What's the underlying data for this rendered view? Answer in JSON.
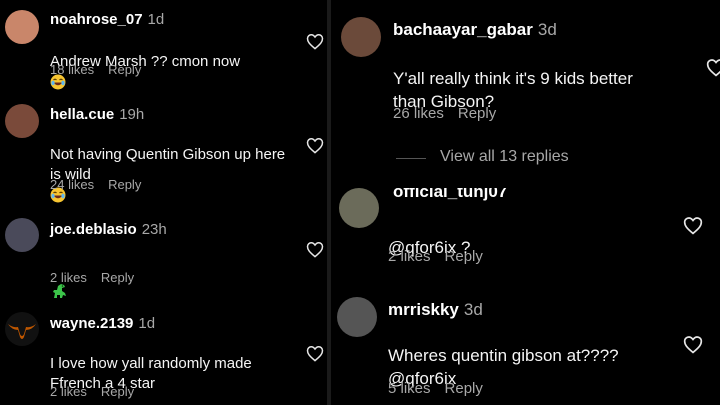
{
  "left_comments": [
    {
      "username": "noahrose_07",
      "age": "1d",
      "text": "Andrew Marsh ?? cmon now",
      "emoji": "laughing-emoji",
      "likes": "18 likes",
      "reply": "Reply",
      "avatar_color": "#c9866a"
    },
    {
      "username": "hella.cue",
      "age": "19h",
      "text": "Not having Quentin Gibson up here\nis wild",
      "emoji": "laughing-emoji",
      "likes": "24 likes",
      "reply": "Reply",
      "avatar_color": "#7a4a3a"
    },
    {
      "username": "joe.deblasio",
      "age": "23h",
      "text": "",
      "emoji": "dinosaur-emoji",
      "likes": "2 likes",
      "reply": "Reply",
      "avatar_color": "#4a4a5a"
    },
    {
      "username": "wayne.2139",
      "age": "1d",
      "text": "I love how yall randomly made\nFfrench a 4 star",
      "emoji": "",
      "likes": "2 likes",
      "reply": "Reply",
      "avatar_color": "#bf5700"
    }
  ],
  "right_comments": [
    {
      "username": "bachaayar_gabar",
      "age": "3d",
      "text": "Y'all really think it's 9 kids better\nthan Gibson?",
      "likes": "26 likes",
      "reply": "Reply",
      "avatar_color": "#6b4a3a"
    },
    {
      "username": "official_tunj07",
      "age": "",
      "text": "@qfor6ix ?",
      "likes": "2 likes",
      "reply": "Reply",
      "avatar_color": "#6b6b5a"
    },
    {
      "username": "mrriskky",
      "age": "3d",
      "text": "Wheres quentin gibson at????\n@qfor6ix",
      "likes": "5 likes",
      "reply": "Reply",
      "avatar_color": "#555"
    }
  ],
  "view_replies": "View all 13 replies"
}
